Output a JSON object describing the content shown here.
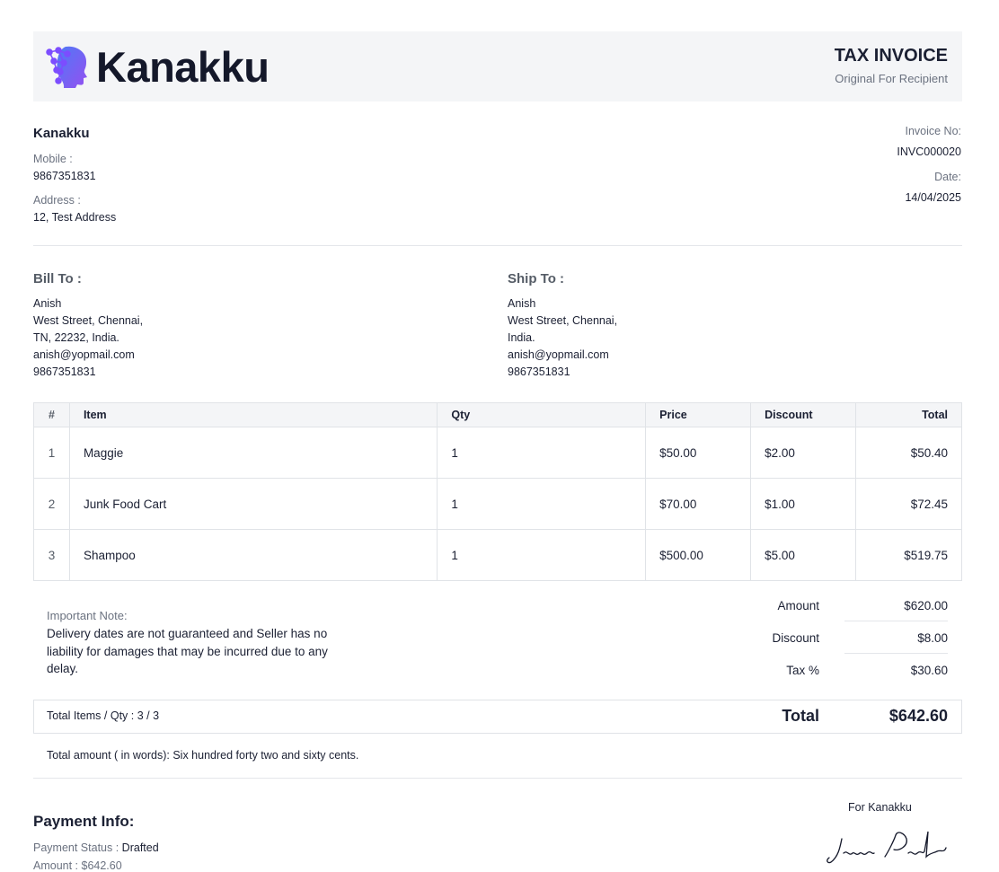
{
  "header": {
    "brand": "Kanakku",
    "title": "TAX INVOICE",
    "subtitle": "Original For Recipient"
  },
  "seller": {
    "name": "Kanakku",
    "mobile_label": "Mobile :",
    "mobile": "9867351831",
    "address_label": "Address :",
    "address": "12, Test Address"
  },
  "invoice_meta": {
    "number_label": "Invoice No:",
    "number": "INVC000020",
    "date_label": "Date:",
    "date": "14/04/2025"
  },
  "bill_to": {
    "title": "Bill To :",
    "lines": [
      "Anish",
      "West Street, Chennai,",
      "TN, 22232, India.",
      "anish@yopmail.com",
      "9867351831"
    ]
  },
  "ship_to": {
    "title": "Ship To :",
    "lines": [
      "Anish",
      "West Street, Chennai,",
      "India.",
      "anish@yopmail.com",
      "9867351831"
    ]
  },
  "table": {
    "headers": [
      "#",
      "Item",
      "Qty",
      "Price",
      "Discount",
      "Total"
    ],
    "rows": [
      [
        "1",
        "Maggie",
        "1",
        "$50.00",
        "$2.00",
        "$50.40"
      ],
      [
        "2",
        "Junk Food Cart",
        "1",
        "$70.00",
        "$1.00",
        "$72.45"
      ],
      [
        "3",
        "Shampoo",
        "1",
        "$500.00",
        "$5.00",
        "$519.75"
      ]
    ]
  },
  "note": {
    "label": "Important Note:",
    "text": "Delivery dates are not guaranteed and Seller has no liability for damages that may be incurred due to any delay."
  },
  "summary": {
    "amount_label": "Amount",
    "amount": "$620.00",
    "discount_label": "Discount",
    "discount": "$8.00",
    "tax_label": "Tax %",
    "tax": "$30.60",
    "items_qty": "Total Items / Qty : 3 / 3",
    "total_label": "Total",
    "total": "$642.60",
    "words": "Total amount ( in words):  Six hundred forty two and sixty cents."
  },
  "payment": {
    "title": "Payment Info:",
    "status_label": "Payment Status :",
    "status": "Drafted",
    "amount_partial": "Amount : $642.60"
  },
  "signature": {
    "for_label": "For Kanakku",
    "name": "James Paulo"
  },
  "colors": {
    "brand_dark": "#14182a",
    "logo_blue": "#3b6cf6",
    "logo_purple": "#8b3df0",
    "band": "#f4f5f7"
  }
}
